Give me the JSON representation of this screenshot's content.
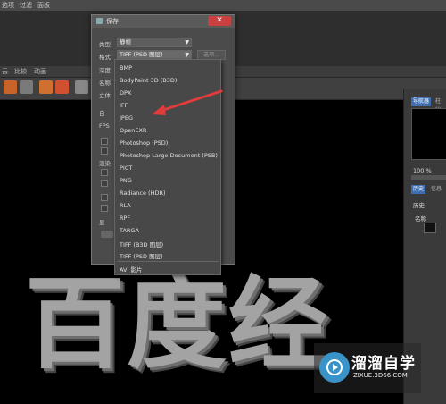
{
  "menu": {
    "items": [
      "选项",
      "过滤",
      "面板"
    ]
  },
  "tool_labels": [
    "云",
    "比较",
    "动画"
  ],
  "dialog": {
    "title": "保存",
    "close_symbol": "✕",
    "type_label": "类型",
    "type_value": "静帧",
    "format_label": "格式",
    "format_value": "TIFF (PSD 图层)",
    "options_button": "选项...",
    "side_labels": [
      "深度",
      "名称",
      "立体",
      "自",
      "FPS",
      "渲染",
      "显"
    ]
  },
  "dropdown": {
    "items": [
      "BMP",
      "BodyPaint 3D (B3D)",
      "DPX",
      "IFF",
      "JPEG",
      "OpenEXR",
      "Photoshop (PSD)",
      "Photoshop Large Document (PSB)",
      "PICT",
      "PNG",
      "Radiance (HDR)",
      "RLA",
      "RPF",
      "TARGA",
      "TIFF (B3D 图层)",
      "TIFF (PSD 图层)"
    ],
    "extra_item": "AVI 影片"
  },
  "viewport": {
    "text": "百度经"
  },
  "right_panel": {
    "tab1": "导航器",
    "tab2": "柱状",
    "zoom": "100 %",
    "tab3": "历史",
    "tab4": "信息",
    "history_label": "历史",
    "name_col": "名称"
  },
  "watermark": {
    "title": "溜溜自学",
    "subtitle": "ZIXUE.3D66.COM"
  },
  "colors": {
    "accent_red": "#e23b3b",
    "close_red": "#c94040",
    "watermark_blue": "#3a93c8"
  }
}
